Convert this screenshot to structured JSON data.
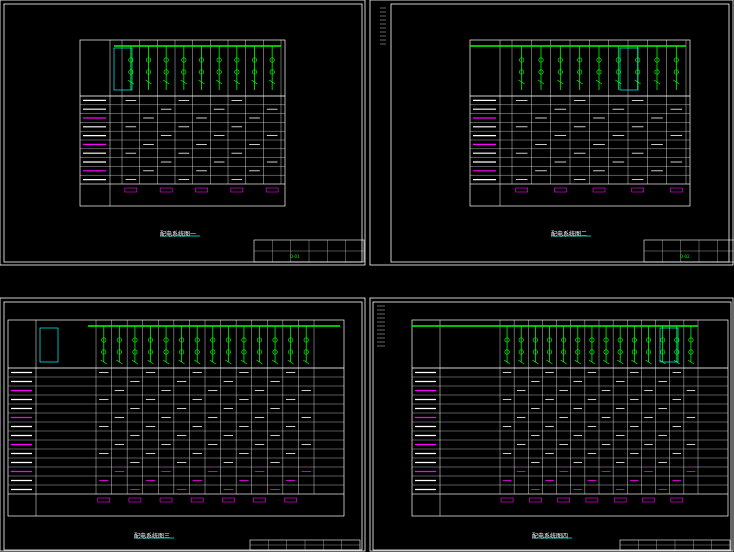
{
  "app": {
    "background": "#000000",
    "frame_color": "#ffffff",
    "sheet_titles": [
      "配电系统图一",
      "配电系统图二",
      "配电系统图三",
      "配电系统图四"
    ],
    "titleblock_codes": [
      "D-01",
      "D-02"
    ]
  },
  "colors": {
    "bus": "#00ff00",
    "device": "#00ff00",
    "cyan": "#00ffff",
    "magenta": "#ff00ff",
    "grid": "#ffffff",
    "text": "#ffffff"
  },
  "sheets": [
    {
      "id": "sheet-1",
      "feeder_count": 9,
      "row_count": 10,
      "bus_side": "left"
    },
    {
      "id": "sheet-2",
      "feeder_count": 9,
      "row_count": 10,
      "bus_side": "right"
    },
    {
      "id": "sheet-3",
      "feeder_count": 14,
      "row_count": 14,
      "bus_side": "left"
    },
    {
      "id": "sheet-4",
      "feeder_count": 14,
      "row_count": 14,
      "bus_side": "right"
    }
  ]
}
